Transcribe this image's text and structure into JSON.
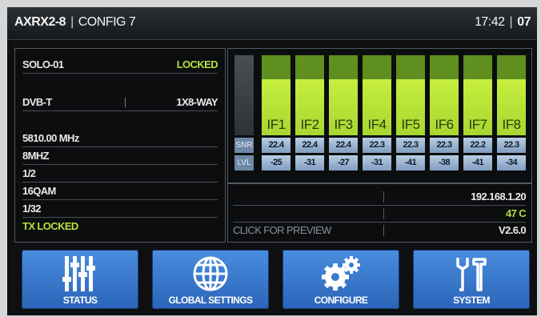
{
  "header": {
    "device": "AXRX2-8",
    "config": "CONFIG 7",
    "time": "17:42",
    "channel": "07"
  },
  "info": {
    "name": "SOLO-01",
    "lock_status": "LOCKED",
    "standard": "DVB-T",
    "mode": "1X8-WAY",
    "frequency": "5810.00 MHz",
    "bandwidth": "8MHZ",
    "code_rate": "1/2",
    "modulation": "16QAM",
    "guard_interval": "1/32",
    "tx_status": "TX LOCKED"
  },
  "signal": {
    "snr_label": "SNR",
    "lvl_label": "LVL",
    "channels": [
      {
        "label": "IF1",
        "snr": "22.4",
        "lvl": "-25",
        "level": 0.7
      },
      {
        "label": "IF2",
        "snr": "22.4",
        "lvl": "-31",
        "level": 0.7
      },
      {
        "label": "IF3",
        "snr": "22.4",
        "lvl": "-27",
        "level": 0.7
      },
      {
        "label": "IF4",
        "snr": "22.3",
        "lvl": "-31",
        "level": 0.7
      },
      {
        "label": "IF5",
        "snr": "22.3",
        "lvl": "-41",
        "level": 0.7
      },
      {
        "label": "IF6",
        "snr": "22.3",
        "lvl": "-38",
        "level": 0.7
      },
      {
        "label": "IF7",
        "snr": "22.2",
        "lvl": "-41",
        "level": 0.7
      },
      {
        "label": "IF8",
        "snr": "22.3",
        "lvl": "-34",
        "level": 0.7
      }
    ]
  },
  "status": {
    "ip": "192.168.1.20",
    "temperature": "47 C",
    "preview_label": "CLICK FOR PREVIEW",
    "version": "V2.6.0"
  },
  "buttons": [
    {
      "label": "STATUS",
      "icon": "sliders-icon"
    },
    {
      "label": "GLOBAL SETTINGS",
      "icon": "globe-icon"
    },
    {
      "label": "CONFIGURE",
      "icon": "gears-icon"
    },
    {
      "label": "SYSTEM",
      "icon": "tools-icon"
    }
  ],
  "colors": {
    "accent_green": "#b6e23a",
    "button_blue": "#3a7bcc",
    "cell_blue": "#9fb7d3"
  }
}
